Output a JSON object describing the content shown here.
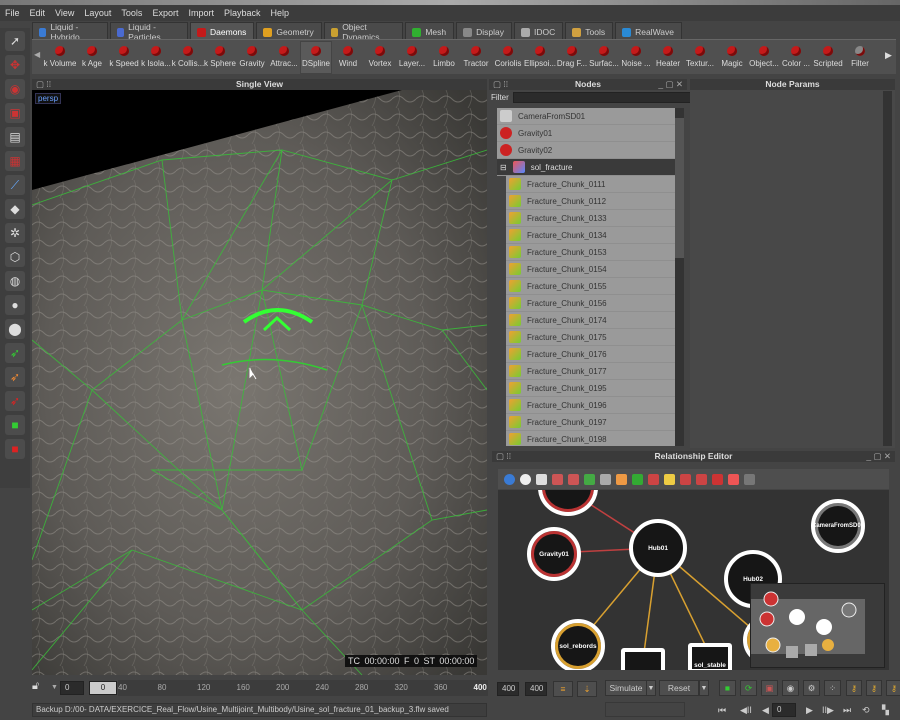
{
  "menu": [
    "File",
    "Edit",
    "View",
    "Layout",
    "Tools",
    "Export",
    "Import",
    "Playback",
    "Help"
  ],
  "tabs": [
    {
      "label": "Liquid - Hybrido",
      "color": "#3a7bd5"
    },
    {
      "label": "Liquid - Particles",
      "color": "#4a6ad0"
    },
    {
      "label": "Daemons",
      "color": "#c41a1a",
      "active": true
    },
    {
      "label": "Geometry",
      "color": "#e0a020"
    },
    {
      "label": "Object Dynamics",
      "color": "#c9a030"
    },
    {
      "label": "Mesh",
      "color": "#30b030"
    },
    {
      "label": "Display",
      "color": "#888888"
    },
    {
      "label": "IDOC",
      "color": "#aaaaaa"
    },
    {
      "label": "Tools",
      "color": "#d0a040"
    },
    {
      "label": "RealWave",
      "color": "#2a8ad5"
    }
  ],
  "daemons": [
    "k Volume",
    "k Age",
    "k Speed",
    "k Isola...",
    "k Collis...",
    "k Sphere",
    "Gravity",
    "Attrac...",
    "DSpline",
    "Wind",
    "Vortex",
    "Layer...",
    "Limbo",
    "Tractor",
    "Coriolis",
    "Ellipsoi...",
    "Drag F...",
    "Surfac...",
    "Noise ...",
    "Heater",
    "Textur...",
    "Magic",
    "Object...",
    "Color ...",
    "Scripted",
    "Filter"
  ],
  "viewport": {
    "title": "Single View",
    "camera": "persp",
    "hud": "TC 00:00:00   F 0   ST 00:00:00"
  },
  "nodes_panel": {
    "title": "Nodes",
    "filter_label": "Filter",
    "filter_value": "",
    "items": [
      {
        "label": "CameraFromSD01",
        "type": "camera"
      },
      {
        "label": "Gravity01",
        "type": "daemon"
      },
      {
        "label": "Gravity02",
        "type": "daemon"
      },
      {
        "label": "sol_fracture",
        "type": "group"
      },
      {
        "label": "Fracture_Chunk_0111",
        "type": "chunk"
      },
      {
        "label": "Fracture_Chunk_0112",
        "type": "chunk"
      },
      {
        "label": "Fracture_Chunk_0133",
        "type": "chunk"
      },
      {
        "label": "Fracture_Chunk_0134",
        "type": "chunk"
      },
      {
        "label": "Fracture_Chunk_0153",
        "type": "chunk"
      },
      {
        "label": "Fracture_Chunk_0154",
        "type": "chunk"
      },
      {
        "label": "Fracture_Chunk_0155",
        "type": "chunk"
      },
      {
        "label": "Fracture_Chunk_0156",
        "type": "chunk"
      },
      {
        "label": "Fracture_Chunk_0174",
        "type": "chunk"
      },
      {
        "label": "Fracture_Chunk_0175",
        "type": "chunk"
      },
      {
        "label": "Fracture_Chunk_0176",
        "type": "chunk"
      },
      {
        "label": "Fracture_Chunk_0177",
        "type": "chunk"
      },
      {
        "label": "Fracture_Chunk_0195",
        "type": "chunk"
      },
      {
        "label": "Fracture_Chunk_0196",
        "type": "chunk"
      },
      {
        "label": "Fracture_Chunk_0197",
        "type": "chunk"
      },
      {
        "label": "Fracture_Chunk_0198",
        "type": "chunk"
      }
    ]
  },
  "params_panel": {
    "title": "Node Params"
  },
  "relationship": {
    "title": "Relationship Editor",
    "nodes": {
      "gravity": "Gravity01",
      "hub1": "Hub01",
      "hub2": "Hub02",
      "camera": "CameraFromSD01",
      "rebords": "sol_rebords",
      "stable": "sol_stable"
    }
  },
  "timeline": {
    "start": "0",
    "current": "0",
    "ticks": [
      "40",
      "80",
      "120",
      "160",
      "200",
      "240",
      "280",
      "320",
      "360",
      "400"
    ],
    "end1": "400",
    "end2": "400"
  },
  "sim": {
    "simulate": "Simulate",
    "reset": "Reset",
    "frame": "0"
  },
  "status": "Backup D:/00- DATA/EXERCICE_Real_Flow/Usine_Multijoint_Multibody/Usine_sol_fracture_01_backup_3.flw saved"
}
